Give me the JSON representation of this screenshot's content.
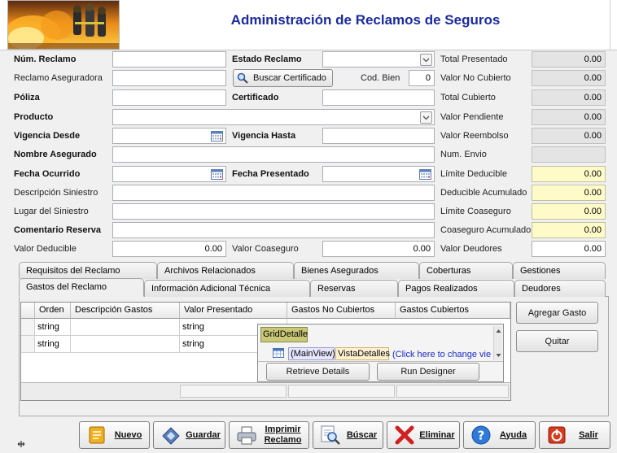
{
  "app": {
    "title": "Administración de Reclamos de Seguros"
  },
  "form": {
    "num_reclamo": {
      "label": "Núm. Reclamo",
      "value": ""
    },
    "estado_reclamo": {
      "label": "Estado Reclamo",
      "value": ""
    },
    "reclamo_aseguradora": {
      "label": "Reclamo Aseguradora",
      "value": ""
    },
    "buscar_certificado": {
      "label": "Buscar Certificado"
    },
    "cod_bien": {
      "label": "Cod. Bien",
      "value": "0"
    },
    "poliza": {
      "label": "Póliza",
      "value": ""
    },
    "certificado": {
      "label": "Certificado",
      "value": ""
    },
    "producto": {
      "label": "Producto",
      "value": ""
    },
    "vigencia_desde": {
      "label": "Vigencia Desde",
      "value": ""
    },
    "vigencia_hasta": {
      "label": "Vigencia Hasta",
      "value": ""
    },
    "nombre_asegurado": {
      "label": "Nombre Asegurado",
      "value": ""
    },
    "fecha_ocurrido": {
      "label": "Fecha Ocurrido",
      "value": ""
    },
    "fecha_presentado": {
      "label": "Fecha Presentado",
      "value": ""
    },
    "descripcion_siniestro": {
      "label": "Descripción Siniestro",
      "value": ""
    },
    "lugar_siniestro": {
      "label": "Lugar del Siniestro",
      "value": ""
    },
    "comentario_reserva": {
      "label": "Comentario Reserva",
      "value": ""
    },
    "valor_deducible": {
      "label": "Valor Deducible",
      "value": "0.00"
    },
    "valor_coaseguro": {
      "label": "Valor Coaseguro",
      "value": "0.00"
    }
  },
  "totals": {
    "total_presentado": {
      "label": "Total Presentado",
      "value": "0.00"
    },
    "valor_no_cubierto": {
      "label": "Valor No Cubierto",
      "value": "0.00"
    },
    "total_cubierto": {
      "label": "Total Cubierto",
      "value": "0.00"
    },
    "valor_pendiente": {
      "label": "Valor Pendiente",
      "value": "0.00"
    },
    "valor_reembolso": {
      "label": "Valor Reembolso",
      "value": "0.00"
    },
    "num_envio": {
      "label": "Num. Envio",
      "value": ""
    },
    "limite_deducible": {
      "label": "Límite Deducible",
      "value": "0.00"
    },
    "deducible_acumulado": {
      "label": "Deducible Acumulado",
      "value": "0.00"
    },
    "limite_coaseguro": {
      "label": "Límite Coaseguro",
      "value": "0.00"
    },
    "coaseguro_acumulado": {
      "label": "Coaseguro Acumulado",
      "value": "0.00"
    },
    "valor_deudores": {
      "label": "Valor Deudores",
      "value": "0.00"
    }
  },
  "tabs": {
    "row1": [
      "Requisitos del Reclamo",
      "Archivos Relacionados",
      "Bienes Asegurados",
      "Coberturas",
      "Gestiones"
    ],
    "row2": [
      "Gastos del Reclamo",
      "Información Adicional Técnica",
      "Reservas",
      "Pagos Realizados",
      "Deudores"
    ]
  },
  "grid": {
    "columns": [
      "Orden",
      "Descripción Gastos",
      "Valor Presentado",
      "Gastos No Cubiertos",
      "Gastos Cubiertos"
    ],
    "rows": [
      [
        "string",
        "",
        "string",
        "",
        ""
      ],
      [
        "string",
        "",
        "string",
        "",
        ""
      ]
    ]
  },
  "popup": {
    "tag": "GridDetalle",
    "mainview": "(MainView)",
    "vista": "VistaDetalles",
    "link": "(Click here to change vie",
    "retrieve": "Retrieve Details",
    "designer": "Run Designer"
  },
  "side_buttons": {
    "agregar": "Agregar Gasto",
    "quitar": "Quitar"
  },
  "toolbar": {
    "nuevo": "Nuevo",
    "guardar": "Guardar",
    "imprimir": "Imprimir Reclamo",
    "buscar": "Búscar",
    "eliminar": "Eliminar",
    "ayuda": "Ayuda",
    "salir": "Salir"
  },
  "colors": {
    "title": "#1a2aa0",
    "readonly": "#e4e4e4",
    "highlight": "#fffbc9"
  }
}
